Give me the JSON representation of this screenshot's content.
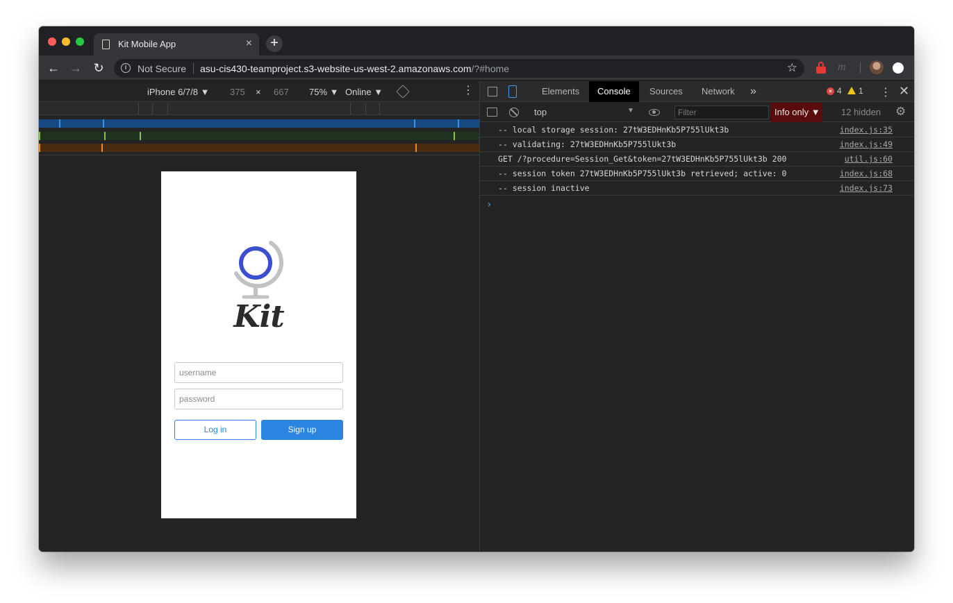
{
  "browser": {
    "tab_title": "Kit Mobile App",
    "tab_close": "×",
    "new_tab": "+",
    "security_label": "Not Secure",
    "url_host": "asu-cis430-teamproject.s3-website-us-west-2.amazonaws.com",
    "url_path": "/?#home",
    "extension_m": "m"
  },
  "device_toolbar": {
    "device": "iPhone 6/7/8 ▼",
    "width": "375",
    "times": "×",
    "height": "667",
    "zoom": "75% ▼",
    "network": "Online ▼"
  },
  "app": {
    "wordmark": "Kit",
    "username_placeholder": "username",
    "password_placeholder": "password",
    "login_label": "Log in",
    "signup_label": "Sign up",
    "brand_color": "#2a84e0",
    "logo_color": "#3b4fcf"
  },
  "devtools": {
    "tabs": [
      "Elements",
      "Console",
      "Sources",
      "Network"
    ],
    "active_tab": "Console",
    "more": "»",
    "error_count": "4",
    "warning_count": "1",
    "context": "top",
    "filter_placeholder": "Filter",
    "level": "Info only ▼",
    "hidden_count": "12 hidden",
    "logs": [
      {
        "message": "-- local storage session: 27tW3EDHnKb5P755lUkt3b",
        "source": "index.js:35"
      },
      {
        "message": "-- validating: 27tW3EDHnKb5P755lUkt3b",
        "source": "index.js:49"
      },
      {
        "message": "GET /?procedure=Session_Get&token=27tW3EDHnKb5P755lUkt3b 200",
        "source": "util.js:60"
      },
      {
        "message": "-- session token 27tW3EDHnKb5P755lUkt3b retrieved; active: 0",
        "source": "index.js:68"
      },
      {
        "message": "-- session inactive",
        "source": "index.js:73"
      }
    ],
    "prompt": "›"
  }
}
